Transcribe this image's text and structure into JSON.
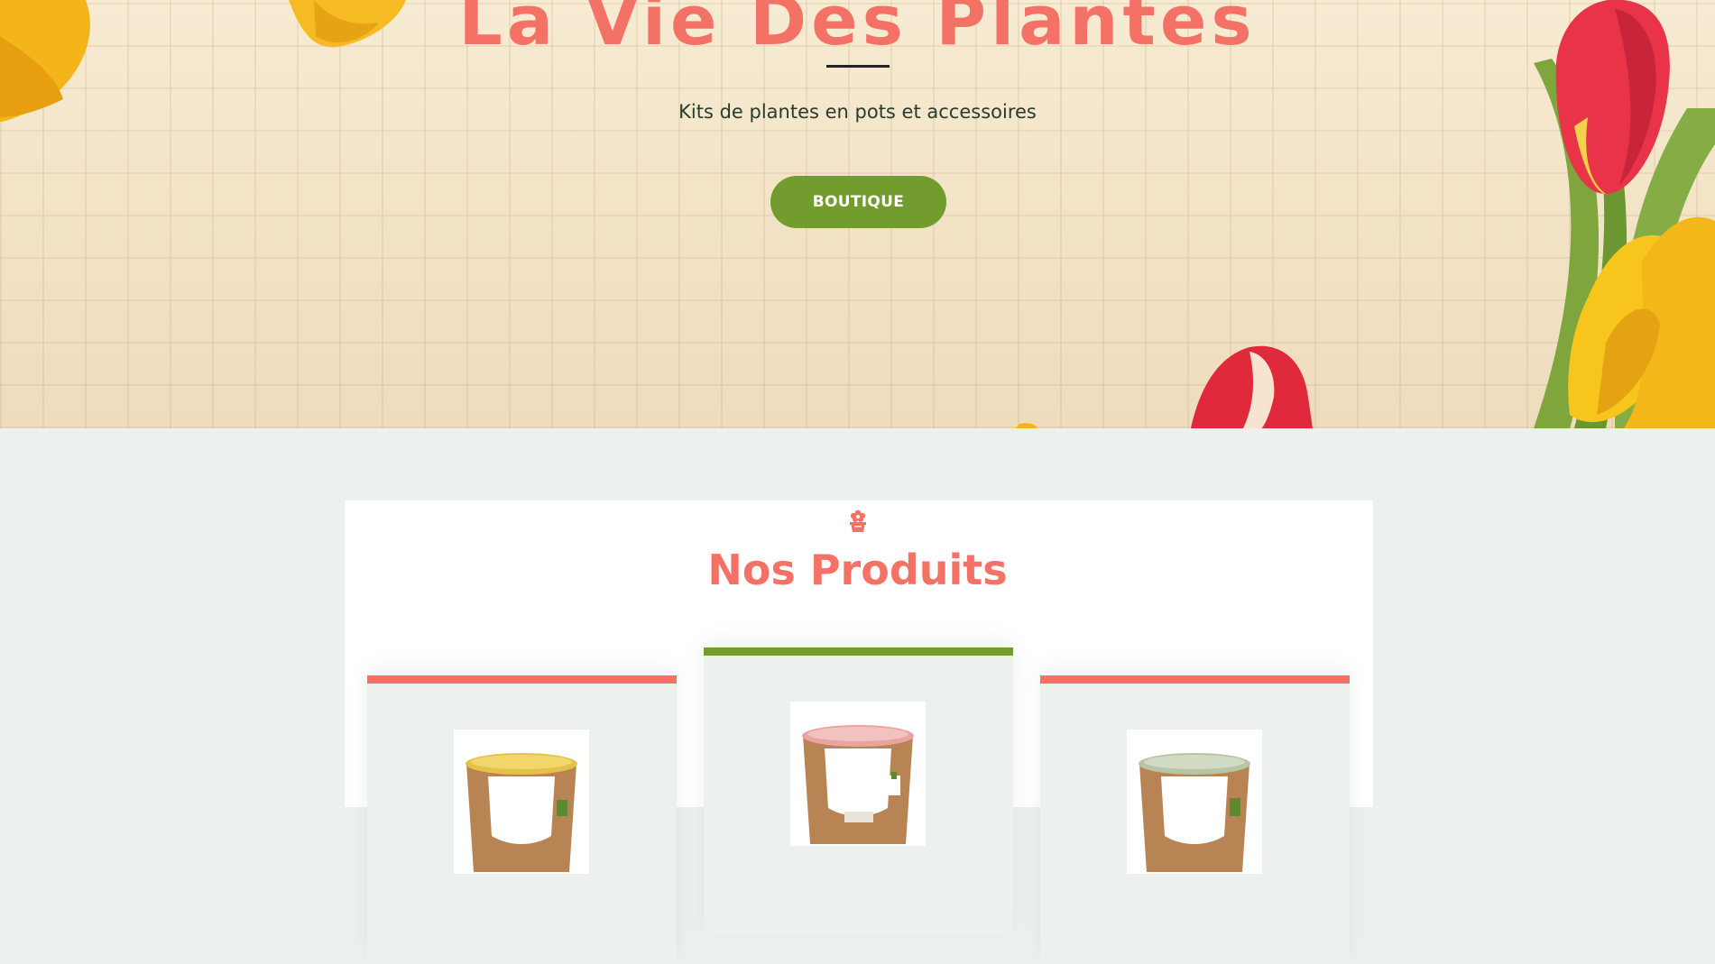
{
  "hero": {
    "title": "La Vie Des Plantes",
    "subtitle": "Kits de plantes en pots et accessoires",
    "cta_label": "BOUTIQUE"
  },
  "products_section": {
    "icon": "flower-pot-icon",
    "title": "Nos Produits"
  },
  "products": [
    {
      "bar_color": "#f47265",
      "lid_color": "#e3c24a"
    },
    {
      "bar_color": "#739c2e",
      "lid_color": "#e9a3a0"
    },
    {
      "bar_color": "#f47265",
      "lid_color": "#b8c4a6"
    }
  ],
  "colors": {
    "accent_coral": "#f47265",
    "accent_green": "#739c2e",
    "section_bg": "#edf1ee"
  }
}
